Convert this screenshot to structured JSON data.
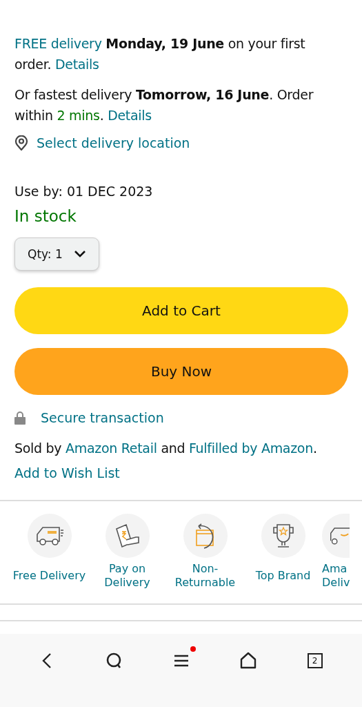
{
  "delivery_lines": [
    [
      {
        "kind": "link",
        "text": "FREE delivery"
      },
      {
        "kind": "text",
        "text": " **Monday, 19 June** on your first order. "
      },
      {
        "kind": "link",
        "text": "Details"
      }
    ],
    [
      {
        "kind": "text",
        "text": "Or fastest delivery **Tomorrow, 16 June**. Order within "
      },
      {
        "kind": "green",
        "text": "2 mins"
      },
      {
        "kind": "text",
        "text": ". "
      },
      {
        "kind": "link",
        "text": "Details"
      }
    ]
  ],
  "location_link": "Select delivery location",
  "use_by": "Use by: 01 DEC 2023",
  "stock_status": "In stock",
  "quantity": {
    "label": "Qty:",
    "value": "1"
  },
  "buttons": [
    {
      "kind": "cart",
      "label": "Add to Cart"
    },
    {
      "kind": "buy",
      "label": "Buy Now"
    }
  ],
  "secure_link": "Secure transaction",
  "sold_by": [
    {
      "kind": "text",
      "text": "Sold by "
    },
    {
      "kind": "link",
      "text": "Amazon Retail"
    },
    {
      "kind": "text",
      "text": " and "
    },
    {
      "kind": "link",
      "text": "Fulfilled by Amazon"
    },
    {
      "kind": "text",
      "text": "."
    }
  ],
  "wish_list_link": "Add to Wish List",
  "features": [
    {
      "kind": "truck",
      "label": "Free Delivery"
    },
    {
      "kind": "cash",
      "label": "Pay on Delivery"
    },
    {
      "kind": "box",
      "label": "Non-Returnable"
    },
    {
      "kind": "trophy",
      "label": "Top Brand"
    },
    {
      "kind": "van",
      "label": "Ama Deliv"
    }
  ],
  "bottom_nav": [
    {
      "kind": "back"
    },
    {
      "kind": "search"
    },
    {
      "kind": "menu",
      "badge": true
    },
    {
      "kind": "home"
    },
    {
      "kind": "tabs",
      "count": "2"
    }
  ]
}
